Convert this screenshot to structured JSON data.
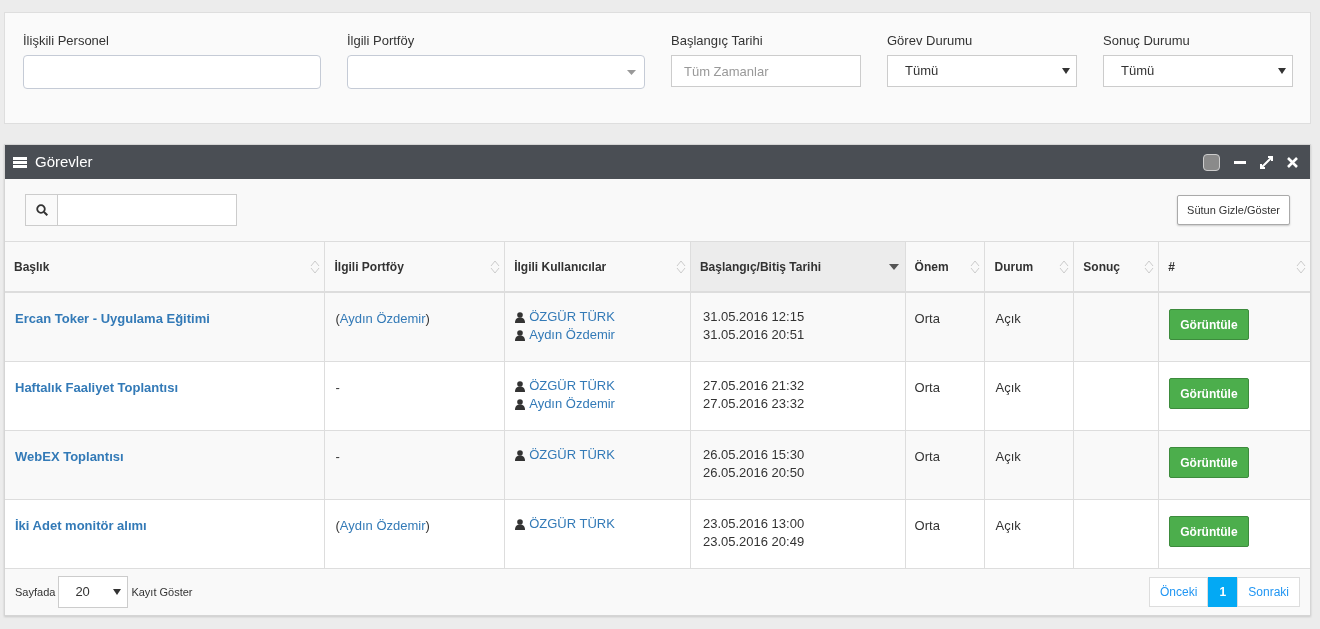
{
  "filters": [
    {
      "label": "İlişkili Personel",
      "kind": "text"
    },
    {
      "label": "İlgili Portföy",
      "kind": "combo"
    },
    {
      "label": "Başlangıç Tarihi",
      "kind": "date",
      "placeholder": "Tüm Zamanlar"
    },
    {
      "label": "Görev Durumu",
      "kind": "select",
      "value": "Tümü"
    },
    {
      "label": "Sonuç Durumu",
      "kind": "select",
      "value": "Tümü"
    }
  ],
  "panel": {
    "title": "Görevler",
    "column_toggle": "Sütun Gizle/Göster"
  },
  "table": {
    "columns": [
      {
        "label": "Başlık",
        "sorted": false
      },
      {
        "label": "İlgili Portföy",
        "sorted": false
      },
      {
        "label": "İlgili Kullanıcılar",
        "sorted": false
      },
      {
        "label": "Başlangıç/Bitiş Tarihi",
        "sorted": true
      },
      {
        "label": "Önem",
        "sorted": false
      },
      {
        "label": "Durum",
        "sorted": false
      },
      {
        "label": "Sonuç",
        "sorted": false
      },
      {
        "label": "#",
        "sorted": false
      }
    ],
    "rows": [
      {
        "title": "Ercan Toker - Uygulama Eğitimi",
        "portfolio": {
          "kind": "link",
          "open": "(",
          "name": "Aydın Özdemir",
          "close": ")"
        },
        "users": [
          "ÖZGÜR TÜRK",
          "Aydın Özdemir"
        ],
        "start": "31.05.2016 12:15",
        "end": "31.05.2016 20:51",
        "priority": "Orta",
        "status": "Açık",
        "action": "Görüntüle"
      },
      {
        "title": "Haftalık Faaliyet Toplantısı",
        "portfolio": {
          "kind": "plain",
          "text": "-"
        },
        "users": [
          "ÖZGÜR TÜRK",
          "Aydın Özdemir"
        ],
        "start": "27.05.2016 21:32",
        "end": "27.05.2016 23:32",
        "priority": "Orta",
        "status": "Açık",
        "action": "Görüntüle"
      },
      {
        "title": "WebEX Toplantısı",
        "portfolio": {
          "kind": "plain",
          "text": "-"
        },
        "users": [
          "ÖZGÜR TÜRK"
        ],
        "start": "26.05.2016 15:30",
        "end": "26.05.2016 20:50",
        "priority": "Orta",
        "status": "Açık",
        "action": "Görüntüle"
      },
      {
        "title": "İki Adet monitör alımı",
        "portfolio": {
          "kind": "link",
          "open": "(",
          "name": "Aydın Özdemir",
          "close": ")"
        },
        "users": [
          "ÖZGÜR TÜRK"
        ],
        "start": "23.05.2016 13:00",
        "end": "23.05.2016 20:49",
        "priority": "Orta",
        "status": "Açık",
        "action": "Görüntüle"
      }
    ]
  },
  "footer": {
    "prefix": "Sayfada",
    "page_size": "20",
    "suffix": "Kayıt Göster",
    "prev": "Önceki",
    "pages": [
      {
        "label": "1",
        "selected": true
      }
    ],
    "next": "Sonraki"
  }
}
